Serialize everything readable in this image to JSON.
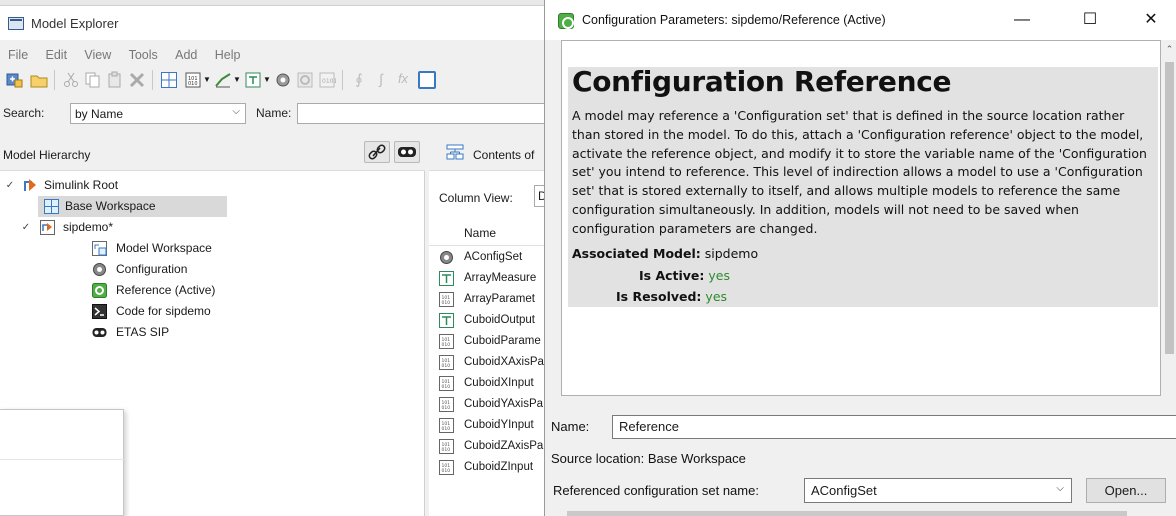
{
  "explorer": {
    "title": "Model Explorer",
    "menu": [
      "File",
      "Edit",
      "View",
      "Tools",
      "Add",
      "Help"
    ],
    "search": {
      "label": "Search:",
      "mode": "by Name",
      "name_label": "Name:",
      "name_value": ""
    },
    "hierarchy": {
      "header": "Model Hierarchy",
      "nodes": [
        {
          "label": "Simulink Root",
          "icon": "simulink-root-icon"
        },
        {
          "label": "Base Workspace",
          "icon": "workspace-grid-icon"
        },
        {
          "label": "sipdemo*",
          "icon": "model-icon"
        },
        {
          "label": "Model Workspace",
          "icon": "model-workspace-icon"
        },
        {
          "label": "Configuration",
          "icon": "gear-cluster-icon"
        },
        {
          "label": "Reference (Active)",
          "icon": "config-reference-icon"
        },
        {
          "label": "Code for sipdemo",
          "icon": "code-icon"
        },
        {
          "label": "ETAS SIP",
          "icon": "mask-icon"
        }
      ]
    },
    "contents": {
      "header": "Contents of",
      "column_view_label": "Column View:",
      "column_view_value": "D",
      "name_col": "Name",
      "rows": [
        {
          "label": "AConfigSet",
          "icon": "gear-cluster-icon"
        },
        {
          "label": "ArrayMeasure",
          "icon": "signal-icon"
        },
        {
          "label": "ArrayParamet",
          "icon": "parameter-icon"
        },
        {
          "label": "CuboidOutput",
          "icon": "signal-icon"
        },
        {
          "label": "CuboidParame",
          "icon": "parameter-icon"
        },
        {
          "label": "CuboidXAxisPa",
          "icon": "parameter-icon"
        },
        {
          "label": "CuboidXInput",
          "icon": "parameter-icon"
        },
        {
          "label": "CuboidYAxisPa",
          "icon": "parameter-icon"
        },
        {
          "label": "CuboidYInput",
          "icon": "parameter-icon"
        },
        {
          "label": "CuboidZAxisPa",
          "icon": "parameter-icon"
        },
        {
          "label": "CuboidZInput",
          "icon": "parameter-icon"
        }
      ]
    }
  },
  "dialog": {
    "title": "Configuration Parameters: sipdemo/Reference (Active)",
    "minimize": "—",
    "maximize": "☐",
    "close": "✕",
    "heading": "Configuration Reference",
    "description": "A model may reference a 'Configuration set' that is defined in the source location rather than stored in the model. To do this, attach a 'Configuration reference' object to the model, activate the reference object, and modify it to store the variable name of the 'Configuration set' you intend to reference. This level of indirection allows a model to use a 'Configuration set' that is stored externally to itself, and allows multiple models to reference the same configuration simultaneously. In addition, models will not need to be saved when configuration parameters are changed.",
    "associated_model_label": "Associated Model:",
    "associated_model_value": "sipdemo",
    "is_active_label": "Is Active:",
    "is_active_value": "yes",
    "is_resolved_label": "Is Resolved:",
    "is_resolved_value": "yes",
    "name_label": "Name:",
    "name_value": "Reference",
    "source_location": "Source location: Base Workspace",
    "ref_label": "Referenced configuration set name:",
    "ref_value": "AConfigSet",
    "open_button": "Open...",
    "status_color": "#2d8a2d"
  }
}
